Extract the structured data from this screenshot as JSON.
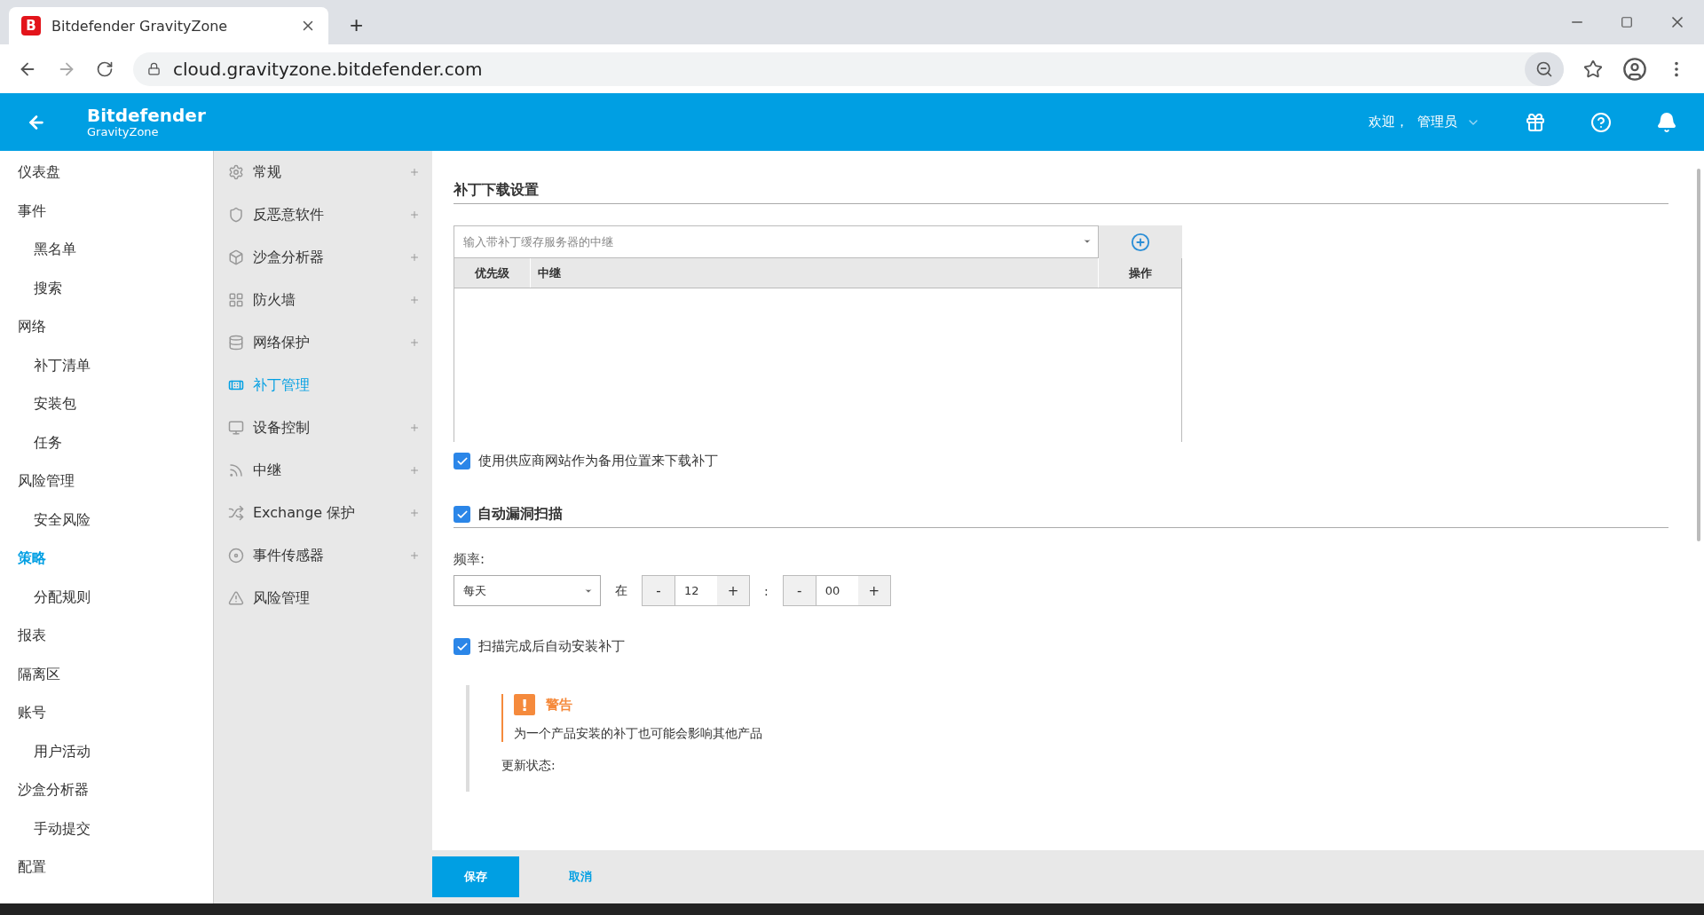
{
  "browser": {
    "tab_title": "Bitdefender GravityZone",
    "favicon": "B",
    "new_tab": "+",
    "url": "cloud.gravityzone.bitdefender.com"
  },
  "header": {
    "brand": "Bitdefender",
    "product": "GravityZone",
    "welcome": "欢迎，",
    "user": "管理员"
  },
  "main_nav": [
    {
      "label": "仪表盘",
      "selected": false
    },
    {
      "label": "事件",
      "selected": false,
      "children": [
        {
          "label": "黑名单",
          "selected": false
        },
        {
          "label": "搜索",
          "selected": false
        }
      ]
    },
    {
      "label": "网络",
      "selected": false,
      "children": [
        {
          "label": "补丁清单",
          "selected": false
        },
        {
          "label": "安装包",
          "selected": false
        },
        {
          "label": "任务",
          "selected": false
        }
      ]
    },
    {
      "label": "风险管理",
      "selected": false,
      "children": [
        {
          "label": "安全风险",
          "selected": false
        }
      ]
    },
    {
      "label": "策略",
      "selected": true,
      "children": [
        {
          "label": "分配规则",
          "selected": false
        }
      ]
    },
    {
      "label": "报表",
      "selected": false
    },
    {
      "label": "隔离区",
      "selected": false
    },
    {
      "label": "账号",
      "selected": false,
      "children": [
        {
          "label": "用户活动",
          "selected": false
        }
      ]
    },
    {
      "label": "沙盒分析器",
      "selected": false,
      "children": [
        {
          "label": "手动提交",
          "selected": false
        }
      ]
    },
    {
      "label": "配置",
      "selected": false
    }
  ],
  "policy_nav": [
    {
      "label": "常规",
      "expandable": true,
      "selected": false
    },
    {
      "label": "反恶意软件",
      "expandable": true,
      "selected": false
    },
    {
      "label": "沙盒分析器",
      "expandable": true,
      "selected": false
    },
    {
      "label": "防火墙",
      "expandable": true,
      "selected": false
    },
    {
      "label": "网络保护",
      "expandable": true,
      "selected": false
    },
    {
      "label": "补丁管理",
      "expandable": false,
      "selected": true
    },
    {
      "label": "设备控制",
      "expandable": true,
      "selected": false
    },
    {
      "label": "中继",
      "expandable": true,
      "selected": false
    },
    {
      "label": "Exchange 保护",
      "expandable": true,
      "selected": false
    },
    {
      "label": "事件传感器",
      "expandable": true,
      "selected": false
    },
    {
      "label": "风险管理",
      "expandable": false,
      "selected": false
    }
  ],
  "download": {
    "title": "补丁下载设置",
    "relay_placeholder": "输入带补丁缓存服务器的中继",
    "columns": [
      "优先级",
      "中继",
      "操作"
    ],
    "vendor_fallback": {
      "label": "使用供应商网站作为备用位置来下载补丁",
      "checked": true
    }
  },
  "scan": {
    "title": "自动漏洞扫描",
    "checked": true,
    "frequency_label": "频率:",
    "frequency": "每天",
    "at": "在",
    "hour": "12",
    "minute": "00",
    "separator": ":",
    "minus": "-",
    "plus": "+",
    "auto_install": {
      "label": "扫描完成后自动安装补丁",
      "checked": true
    },
    "warning": {
      "mark": "!",
      "title": "警告",
      "text": "为一个产品安装的补丁也可能会影响其他产品"
    },
    "update_status": "更新状态:"
  },
  "footer": {
    "save": "保存",
    "cancel": "取消"
  }
}
